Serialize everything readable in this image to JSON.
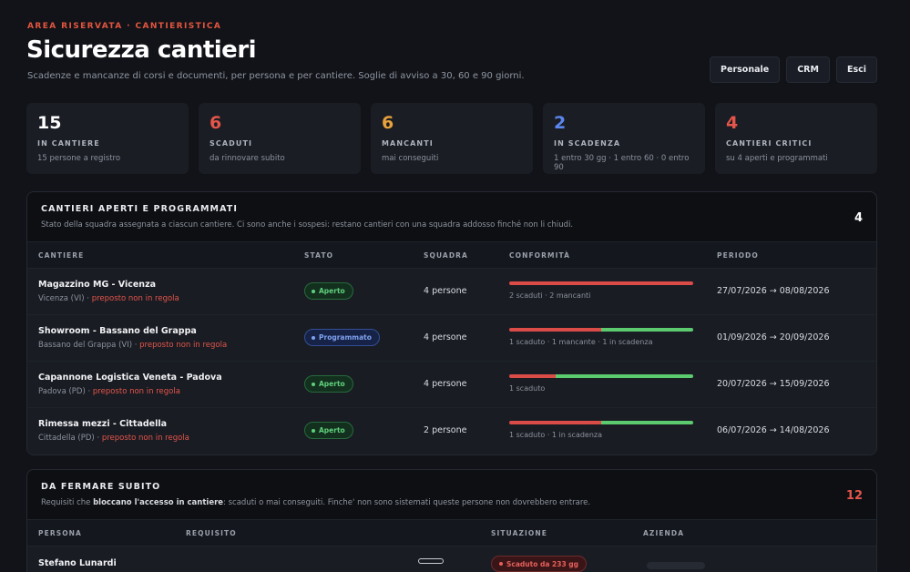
{
  "header": {
    "eyebrow": "AREA RISERVATA · CANTIERISTICA",
    "title": "Sicurezza cantieri",
    "subtitle": "Scadenze e mancanze di corsi e documenti, per persona e per cantiere. Soglie di avviso a 30, 60 e 90 giorni.",
    "buttons": [
      "Personale",
      "CRM",
      "Esci"
    ]
  },
  "stats": [
    {
      "value": "15",
      "label": "IN CANTIERE",
      "sub": "15 persone a registro",
      "color": "#ffffff"
    },
    {
      "value": "6",
      "label": "SCADUTI",
      "sub": "da rinnovare subito",
      "color": "#e4554a"
    },
    {
      "value": "6",
      "label": "MANCANTI",
      "sub": "mai conseguiti",
      "color": "#e9a23b"
    },
    {
      "value": "2",
      "label": "IN SCADENZA",
      "sub": "1 entro 30 gg · 1 entro 60 · 0 entro 90",
      "color": "#5b86f0"
    },
    {
      "value": "4",
      "label": "CANTIERI CRITICI",
      "sub": "su 4 aperti e programmati",
      "color": "#e4554a"
    }
  ],
  "sites": {
    "title": "CANTIERI APERTI E PROGRAMMATI",
    "description": "Stato della squadra assegnata a ciascun cantiere. Ci sono anche i sospesi: restano cantieri con una squadra addosso finché non li chiudi.",
    "count": "4",
    "columns": [
      "CANTIERE",
      "STATO",
      "SQUADRA",
      "CONFORMITÀ",
      "PERIODO"
    ],
    "rows": [
      {
        "name": "Magazzino MG - Vicenza",
        "location": "Vicenza (VI)",
        "warning": "preposto non in regola",
        "status": "Aperto",
        "status_kind": "open",
        "team": "4 persone",
        "compliance_ok": 0,
        "compliance_text": "2 scaduti · 2 mancanti",
        "period": "27/07/2026 → 08/08/2026"
      },
      {
        "name": "Showroom - Bassano del Grappa",
        "location": "Bassano del Grappa (VI)",
        "warning": "preposto non in regola",
        "status": "Programmato",
        "status_kind": "prog",
        "team": "4 persone",
        "compliance_ok": 0.5,
        "compliance_text": "1 scaduto · 1 mancante · 1 in scadenza",
        "period": "01/09/2026 → 20/09/2026"
      },
      {
        "name": "Capannone Logistica Veneta - Padova",
        "location": "Padova (PD)",
        "warning": "preposto non in regola",
        "status": "Aperto",
        "status_kind": "open",
        "team": "4 persone",
        "compliance_ok": 0.75,
        "compliance_text": "1 scaduto",
        "period": "20/07/2026 → 15/09/2026"
      },
      {
        "name": "Rimessa mezzi - Cittadella",
        "location": "Cittadella (PD)",
        "warning": "preposto non in regola",
        "status": "Aperto",
        "status_kind": "open",
        "team": "2 persone",
        "compliance_ok": 0.5,
        "compliance_text": "1 scaduto · 1 in scadenza",
        "period": "06/07/2026 → 14/08/2026"
      }
    ]
  },
  "stop": {
    "title": "DA FERMARE SUBITO",
    "description_pre": "Requisiti che ",
    "description_bold": "bloccano l'accesso in cantiere",
    "description_post": ": scaduti o mai conseguiti. Finche' non sono sistemati queste persone non dovrebbero entrare.",
    "count": "12",
    "columns": [
      "PERSONA",
      "REQUISITO",
      "SITUAZIONE",
      "AZIENDA"
    ],
    "rows": [
      {
        "person": "Stefano Lunardi",
        "situation": "Scaduto da 233 gg"
      }
    ]
  },
  "colors": {
    "accent_red": "#e4554a",
    "accent_amber": "#e9a23b",
    "accent_blue": "#5b86f0",
    "ok_green": "#5ccb6f"
  }
}
